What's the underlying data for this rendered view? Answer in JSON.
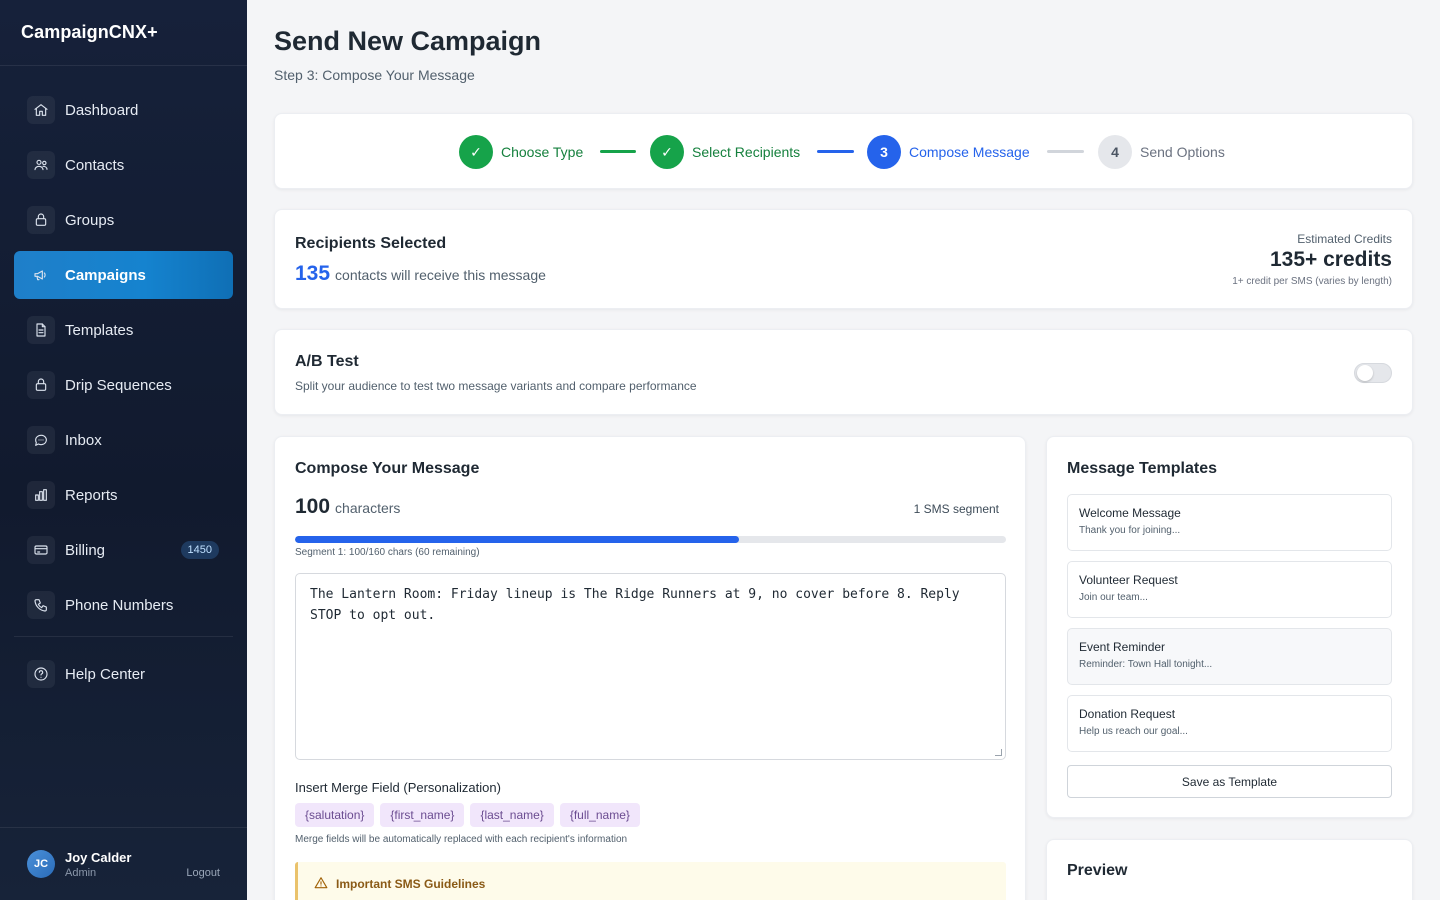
{
  "app": {
    "name": "CampaignCNX+"
  },
  "sidebar": {
    "items": [
      {
        "label": "Dashboard",
        "icon": "home-icon"
      },
      {
        "label": "Contacts",
        "icon": "users-icon"
      },
      {
        "label": "Groups",
        "icon": "lock-icon"
      },
      {
        "label": "Campaigns",
        "icon": "megaphone-icon",
        "active": true
      },
      {
        "label": "Templates",
        "icon": "document-icon"
      },
      {
        "label": "Drip Sequences",
        "icon": "lock-icon"
      },
      {
        "label": "Inbox",
        "icon": "chat-bubble-icon"
      },
      {
        "label": "Reports",
        "icon": "bar-chart-icon"
      },
      {
        "label": "Billing",
        "icon": "credit-card-icon",
        "badge": "1450"
      },
      {
        "label": "Phone Numbers",
        "icon": "phone-icon"
      },
      {
        "label": "Help Center",
        "icon": "help-circle-icon"
      }
    ],
    "user": {
      "initials": "JC",
      "name": "Joy Calder",
      "role": "Admin",
      "logout": "Logout"
    }
  },
  "page": {
    "title": "Send New Campaign",
    "subtitle": "Step 3: Compose Your Message"
  },
  "stepper": {
    "steps": [
      {
        "marker": "✓",
        "label": "Choose Type",
        "status": "done"
      },
      {
        "marker": "✓",
        "label": "Select Recipients",
        "status": "done"
      },
      {
        "marker": "3",
        "label": "Compose Message",
        "status": "current"
      },
      {
        "marker": "4",
        "label": "Send Options",
        "status": "todo"
      }
    ]
  },
  "recipients": {
    "title": "Recipients Selected",
    "count": "135",
    "text": "contacts will receive this message",
    "credits_label": "Estimated Credits",
    "credits_value": "135+ credits",
    "credits_note": "1+ credit per SMS (varies by length)"
  },
  "ab_test": {
    "title": "A/B Test",
    "description": "Split your audience to test two message variants and compare performance",
    "enabled": false
  },
  "compose": {
    "title": "Compose Your Message",
    "char_count": "100",
    "char_label": "characters",
    "segment_count": "1 SMS segment",
    "progress_fraction": 0.625,
    "segment_note": "Segment 1: 100/160 chars (60 remaining)",
    "message": "The Lantern Room: Friday lineup is The Ridge Runners at 9, no cover before 8. Reply STOP to opt out.",
    "merge_label": "Insert Merge Field (Personalization)",
    "merge_fields": [
      "{salutation}",
      "{first_name}",
      "{last_name}",
      "{full_name}"
    ],
    "merge_note": "Merge fields will be automatically replaced with each recipient's information",
    "guidelines_title": "Important SMS Guidelines"
  },
  "templates": {
    "title": "Message Templates",
    "items": [
      {
        "name": "Welcome Message",
        "snippet": "Thank you for joining..."
      },
      {
        "name": "Volunteer Request",
        "snippet": "Join our team..."
      },
      {
        "name": "Event Reminder",
        "snippet": "Reminder: Town Hall tonight..."
      },
      {
        "name": "Donation Request",
        "snippet": "Help us reach our goal..."
      }
    ],
    "save_label": "Save as Template"
  },
  "preview": {
    "title": "Preview"
  },
  "colors": {
    "accent": "#2563eb",
    "success": "#16a34a",
    "sidebar": "#16213a",
    "active_nav": "#1f7fc9"
  }
}
